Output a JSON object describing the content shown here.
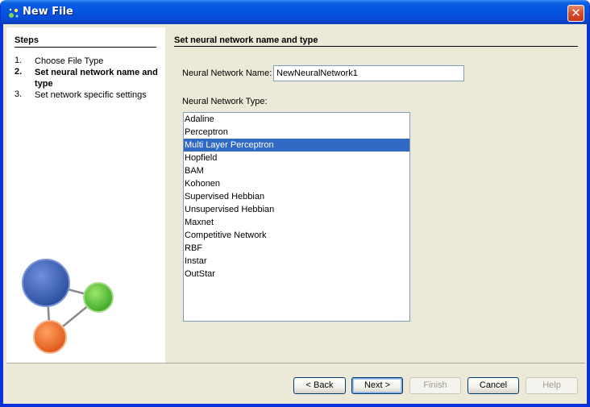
{
  "window": {
    "title": "New File",
    "close_label": "✕"
  },
  "steps": {
    "title": "Steps",
    "items": [
      {
        "num": "1.",
        "label": "Choose File Type"
      },
      {
        "num": "2.",
        "label": "Set neural network name and type"
      },
      {
        "num": "3.",
        "label": "Set network specific settings"
      }
    ]
  },
  "content": {
    "title": "Set neural network name and type",
    "name_label": "Neural Network Name:",
    "name_value": "NewNeuralNetwork1",
    "type_label": "Neural Network Type:",
    "types": [
      "Adaline",
      "Perceptron",
      "Multi Layer Perceptron",
      "Hopfield",
      "BAM",
      "Kohonen",
      "Supervised Hebbian",
      "Unsupervised Hebbian",
      "Maxnet",
      "Competitive Network",
      "RBF",
      "Instar",
      "OutStar"
    ],
    "selected_type": "Multi Layer Perceptron"
  },
  "buttons": {
    "back": "< Back",
    "next": "Next >",
    "finish": "Finish",
    "cancel": "Cancel",
    "help": "Help"
  },
  "colors": {
    "titlebar": "#0554e3",
    "selection": "#316ac5",
    "node_blue": "#3a5fb8",
    "node_green": "#5cc43d",
    "node_orange": "#f07028"
  },
  "icons": {
    "app": "new-file-sparkle-icon",
    "close": "close-icon",
    "logo": "network-nodes-icon"
  }
}
